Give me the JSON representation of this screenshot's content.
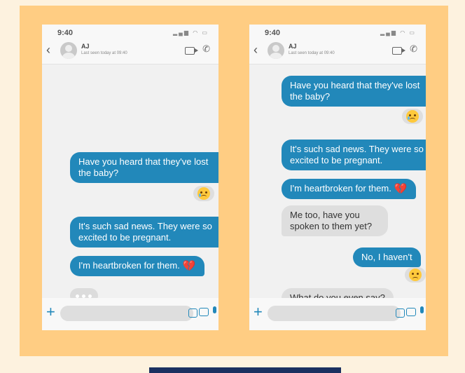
{
  "statusbar": {
    "time": "9:40"
  },
  "contact": {
    "name": "AJ",
    "last_seen": "Last seen today at 09:40"
  },
  "messages": {
    "heard": "Have you heard that they've lost the baby?",
    "sad_news": "It's such sad news. They were so excited to be pregnant.",
    "heartbroken": "I'm heartbroken for them.",
    "me_too": "Me too, have you spoken to them yet?",
    "no_havent": "No, I haven't",
    "what_say": "What do you even say?"
  },
  "icons": {
    "back": "chevron-left-icon",
    "avatar": "avatar-icon",
    "video": "video-call-icon",
    "call": "phone-icon",
    "plus": "plus-icon",
    "sticker": "sticker-icon",
    "camera": "camera-icon",
    "mic": "microphone-icon",
    "crying": "crying-face-emoji",
    "broken_heart": "broken-heart-emoji",
    "frown": "frowning-face-emoji"
  },
  "colors": {
    "sent": "#2288ba",
    "received": "#dedede",
    "background": "#ffcd83"
  }
}
